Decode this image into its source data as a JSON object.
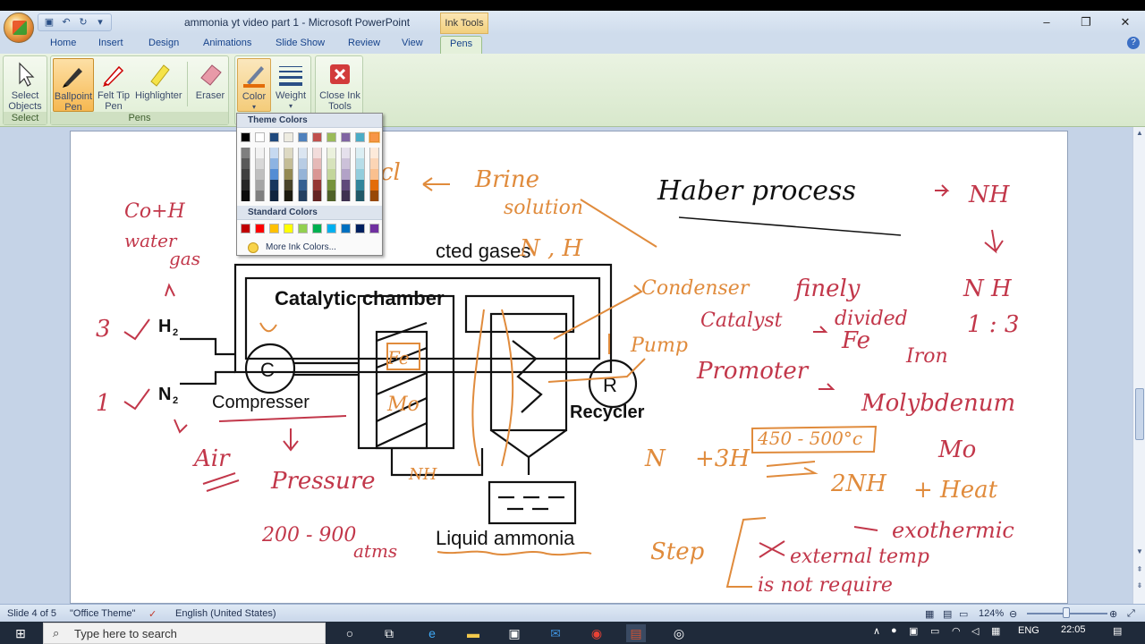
{
  "window": {
    "title": "ammonia yt video part 1 - Microsoft PowerPoint",
    "context_tab": "Ink Tools",
    "controls": [
      "–",
      "❐",
      "✕"
    ]
  },
  "quick_access": [
    "save-icon",
    "undo-icon",
    "redo-icon",
    "customize-icon"
  ],
  "tabs": [
    "Home",
    "Insert",
    "Design",
    "Animations",
    "Slide Show",
    "Review",
    "View",
    "Pens"
  ],
  "active_tab": "Pens",
  "ribbon": {
    "select_group": {
      "label": "Select",
      "button": "Select Objects"
    },
    "pens_group": {
      "label": "Pens",
      "buttons": [
        "Ballpoint Pen",
        "Felt Tip Pen",
        "Highlighter",
        "Eraser"
      ],
      "color": "Color",
      "weight": "Weight"
    },
    "close": "Close Ink Tools"
  },
  "color_menu": {
    "theme_header": "Theme Colors",
    "standard_header": "Standard Colors",
    "more": "More Ink Colors...",
    "theme_top": [
      "#000000",
      "#ffffff",
      "#1f497d",
      "#eeece1",
      "#4f81bd",
      "#c0504d",
      "#9bbb59",
      "#8064a2",
      "#4bacc6",
      "#f79646"
    ],
    "theme_shades": [
      [
        "#7f7f7f",
        "#595959",
        "#3f3f3f",
        "#262626",
        "#0c0c0c"
      ],
      [
        "#f2f2f2",
        "#d8d8d8",
        "#bfbfbf",
        "#a5a5a5",
        "#7f7f7f"
      ],
      [
        "#c6d9f0",
        "#8db3e2",
        "#548dd4",
        "#17365d",
        "#0f243e"
      ],
      [
        "#ddd9c3",
        "#c4bd97",
        "#938953",
        "#494429",
        "#1d1b10"
      ],
      [
        "#dbe5f1",
        "#b8cce4",
        "#95b3d7",
        "#366092",
        "#244061"
      ],
      [
        "#f2dcdb",
        "#e5b9b7",
        "#d99694",
        "#953734",
        "#632423"
      ],
      [
        "#ebf1dd",
        "#d7e3bc",
        "#c3d69b",
        "#76923c",
        "#4f6128"
      ],
      [
        "#e5e0ec",
        "#ccc1d9",
        "#b2a2c7",
        "#5f497a",
        "#3f3151"
      ],
      [
        "#dbeef3",
        "#b7dde8",
        "#92cddc",
        "#31859b",
        "#205867"
      ],
      [
        "#fdeada",
        "#fbd5b5",
        "#fac08f",
        "#e36c09",
        "#974806"
      ]
    ],
    "standard": [
      "#c00000",
      "#ff0000",
      "#ffc000",
      "#ffff00",
      "#92d050",
      "#00b050",
      "#00b0f0",
      "#0070c0",
      "#002060",
      "#7030a0"
    ]
  },
  "slide": {
    "diagram_labels": {
      "unreacted": "cted gases",
      "chamber": "Catalytic chamber",
      "compressor": "Compresser",
      "recycler": "Recycler",
      "liquid": "Liquid ammonia",
      "h2": "H",
      "n2": "N",
      "sub2": "2",
      "c": "C",
      "r": "R"
    },
    "ink": {
      "brine1": "Brine",
      "brine2": "solution",
      "cl": "cl",
      "co_h2": "Co+H",
      "water_gas1": "water",
      "water_gas2": "gas",
      "three": "3",
      "one": "1",
      "air": "Air",
      "pressure": "Pressure",
      "atm1": "200 - 900",
      "atm2": "atms",
      "n2h2": "N , H",
      "condenser": "Condenser",
      "pump": "Pump",
      "fe_box": "Fe",
      "mo": "Mo",
      "nh3_bottom": "NH",
      "haber": "Haber process",
      "nh3_top": "NH",
      "nh_split": "N   H",
      "ratio": "1 : 3",
      "finely": "finely",
      "divided": "divided",
      "catalyst": "Catalyst",
      "fe": "Fe",
      "iron": "Iron",
      "promoter": "Promoter",
      "molyb": "Molybdenum",
      "mo2": "Mo",
      "temp": "450 - 500°c",
      "equation_left": "N",
      "equation_mid": "+3H",
      "equation_right": "2NH",
      "heat": "+ Heat",
      "exothermic": "exothermic",
      "step": "Step",
      "external": "external temp",
      "not_req": "is not require"
    }
  },
  "status": {
    "slide": "Slide 4 of 5",
    "theme": "\"Office Theme\"",
    "language": "English (United States)",
    "zoom": "124%"
  },
  "taskbar": {
    "search": "Type here to search",
    "lang": "ENG",
    "time": "22:05"
  }
}
